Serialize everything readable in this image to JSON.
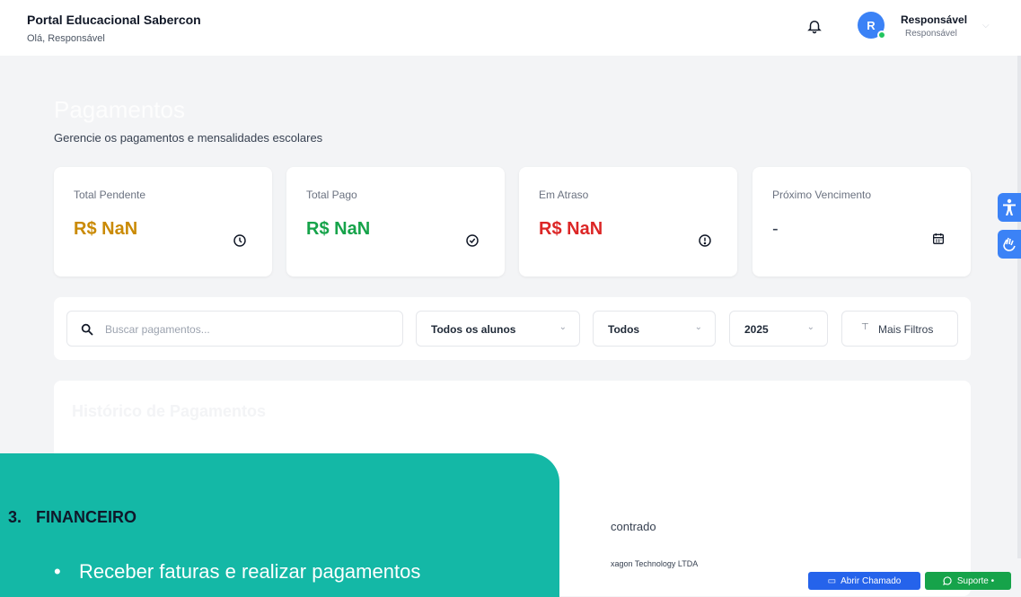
{
  "header": {
    "portal_title": "Portal Educacional Sabercon",
    "greeting": "Olá, Responsável",
    "user": {
      "initial": "R",
      "name": "Responsável",
      "role": "Responsável"
    }
  },
  "page": {
    "title": "Pagamentos",
    "subtitle": "Gerencie os pagamentos e mensalidades escolares"
  },
  "summary_cards": [
    {
      "label": "Total Pendente",
      "value": "R$ NaN",
      "color": "#ca8a04",
      "icon": "clock-icon"
    },
    {
      "label": "Total Pago",
      "value": "R$ NaN",
      "color": "#16a34a",
      "icon": "check-circle-icon"
    },
    {
      "label": "Em Atraso",
      "value": "R$ NaN",
      "color": "#dc2626",
      "icon": "alert-circle-icon"
    },
    {
      "label": "Próximo Vencimento",
      "value": "-",
      "color": "#374151",
      "icon": "calendar-icon"
    }
  ],
  "filters": {
    "search_placeholder": "Buscar pagamentos...",
    "student_select": "Todos os alunos",
    "status_select": "Todos",
    "year_select": "2025",
    "more_filters": "Mais Filtros"
  },
  "history": {
    "title": "Histórico de Pagamentos",
    "empty_text": "contrado",
    "footer_text": "xagon Technology LTDA"
  },
  "floating_buttons": {
    "ticket": "Abrir Chamado",
    "support": "Suporte •"
  },
  "overlay": {
    "number": "3.",
    "heading": "FINANCEIRO",
    "bullet": "Receber faturas e realizar pagamentos"
  }
}
